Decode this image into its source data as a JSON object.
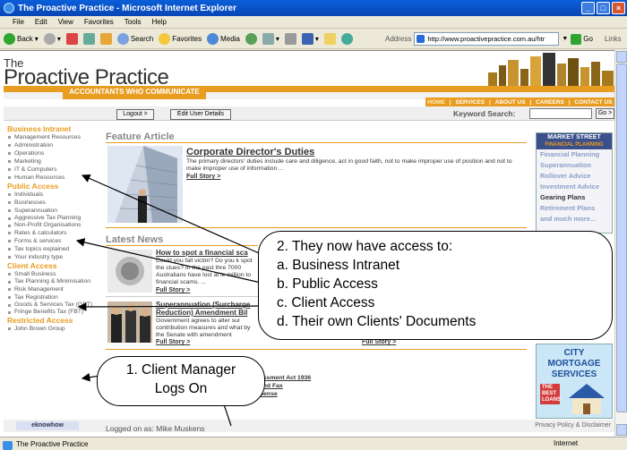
{
  "window": {
    "title": "The Proactive Practice - Microsoft Internet Explorer"
  },
  "menu": [
    "File",
    "Edit",
    "View",
    "Favorites",
    "Tools",
    "Help"
  ],
  "toolbar": {
    "back": "Back",
    "search": "Search",
    "favorites": "Favorites",
    "media": "Media",
    "address_label": "Address",
    "url": "http://www.proactivepractice.com.au/htr",
    "go": "Go",
    "links": "Links"
  },
  "site": {
    "logo_the": "The",
    "logo_name": "Proactive Practice",
    "tagline": "ACCOUNTANTS WHO COMMUNICATE",
    "nav": [
      "HOME",
      "SERVICES",
      "ABOUT US",
      "CAREERS",
      "CONTACT US"
    ],
    "logout": "Logout >",
    "edit_user": "Edit User Details",
    "keyword_label": "Keyword Search:",
    "keyword_go": "Go >",
    "left_sections": [
      {
        "title": "Business Intranet",
        "items": [
          "Management Resources",
          "Administration",
          "Operations",
          "Marketing",
          "IT & Computers",
          "Human Resources"
        ]
      },
      {
        "title": "Public Access",
        "items": [
          "Individuals",
          "Businesses",
          "Superannuation",
          "Aggressive Tax Planning",
          "Non-Profit Organisations",
          "Rates & calculators",
          "Forms & services",
          "Tax topics explained",
          "Your industry type"
        ]
      },
      {
        "title": "Client Access",
        "items": [
          "Small Business",
          "Tax Planning & Minimisation",
          "Risk Management",
          "Tax Registration",
          "Goods & Services Tax (GST)",
          "Fringe Benefits Tax (FBT)"
        ]
      },
      {
        "title": "Restricted Access",
        "items": [
          "John Brown Group"
        ]
      }
    ],
    "feature_heading": "Feature Article",
    "feature_title": "Corporate Director's Duties",
    "feature_text": "The primary directors' duties include care and diligence, act in good faith, not to make improper use of position and not to make improper use of information ...",
    "full_story": "Full Story >",
    "latest_heading": "Latest News",
    "news": [
      {
        "title": "How to spot a financial sca",
        "text": "Could you fall victim? Do you k spot the clues? In the past thre 7000 Australians have lost at le million to financial scams. ..."
      },
      {
        "title": "Superannuation (Surcharge Reduction) Amendment Bil",
        "text": "Government agrees to alter sur contribution measures and what by the Senate with amendment"
      }
    ],
    "news3": [
      "essment Act 1936",
      "and Fax",
      "pense"
    ],
    "market": {
      "title": "MARKET STREET",
      "subtitle": "FINANCIAL PLANNING",
      "items": [
        "Financial Planning",
        "Superannuation",
        "Rollover Advice",
        "Investment Advice",
        "Gearing Plans",
        "Retirement Plans",
        "and much more..."
      ]
    },
    "ad": {
      "lines": [
        "CITY",
        "MORTGAGE",
        "SERVICES"
      ],
      "small": [
        "THE",
        "BEST",
        "LOANS"
      ]
    },
    "logged_in": "Logged on as: Mike Muskens",
    "eknowhow": "eknowhow",
    "privacy": "Privacy Policy & Disclaimer"
  },
  "status": {
    "left": "The Proactive Practice",
    "zone": "Internet"
  },
  "callout_access": [
    "2.  They now have access to:",
    "a.   Business Intranet",
    "b.   Public Access",
    "c.   Client Access",
    "d.   Their own Clients' Documents"
  ],
  "callout_logon": [
    "1. Client Manager",
    "Logs On"
  ]
}
